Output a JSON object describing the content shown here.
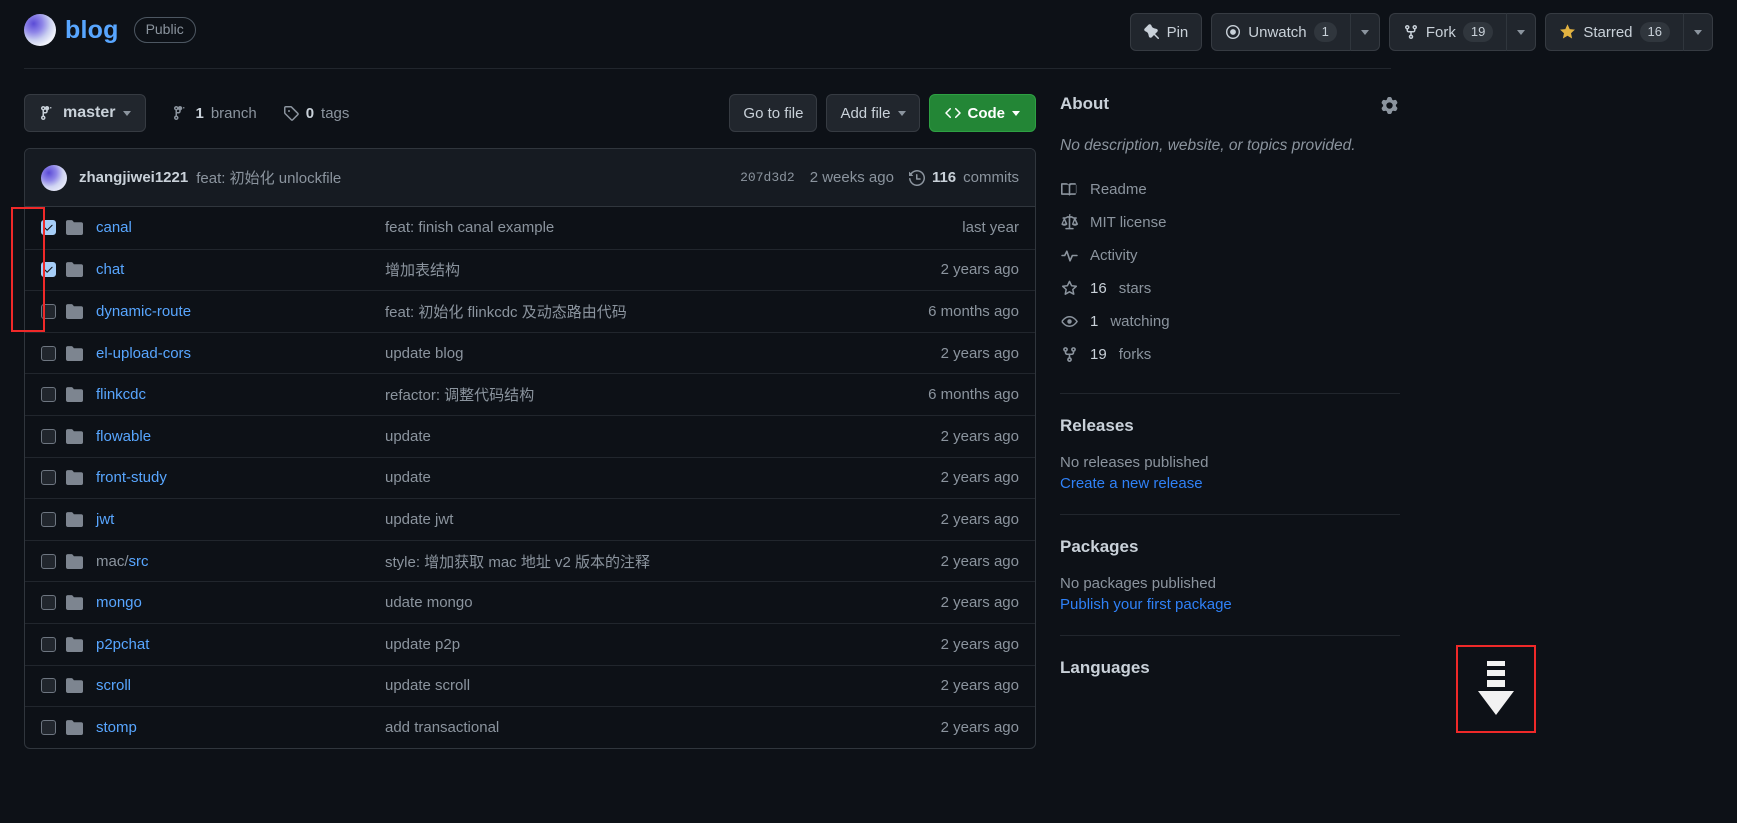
{
  "header": {
    "repo_name": "blog",
    "visibility": "Public",
    "pin_label": "Pin",
    "watch_label": "Unwatch",
    "watch_count": "1",
    "fork_label": "Fork",
    "fork_count": "19",
    "star_label": "Starred",
    "star_count": "16"
  },
  "toolbar": {
    "branch": "master",
    "branch_count": "1",
    "branch_label": "branch",
    "tag_count": "0",
    "tag_label": "tags",
    "go_to_file": "Go to file",
    "add_file": "Add file",
    "code": "Code"
  },
  "commit": {
    "author": "zhangjiwei1221",
    "message": "feat: 初始化 unlockfile",
    "sha": "207d3d2",
    "date": "2 weeks ago",
    "commits_count": "116",
    "commits_label": "commits"
  },
  "files": [
    {
      "name": "canal",
      "name_prefix": "",
      "message": "feat: finish canal example",
      "time": "last year",
      "checked": true
    },
    {
      "name": "chat",
      "name_prefix": "",
      "message": "增加表结构",
      "time": "2 years ago",
      "checked": true
    },
    {
      "name": "dynamic-route",
      "name_prefix": "",
      "message": "feat: 初始化 flinkcdc 及动态路由代码",
      "time": "6 months ago",
      "checked": false
    },
    {
      "name": "el-upload-cors",
      "name_prefix": "",
      "message": "update blog",
      "time": "2 years ago",
      "checked": false
    },
    {
      "name": "flinkcdc",
      "name_prefix": "",
      "message": "refactor: 调整代码结构",
      "time": "6 months ago",
      "checked": false
    },
    {
      "name": "flowable",
      "name_prefix": "",
      "message": "update",
      "time": "2 years ago",
      "checked": false
    },
    {
      "name": "front-study",
      "name_prefix": "",
      "message": "update",
      "time": "2 years ago",
      "checked": false
    },
    {
      "name": "jwt",
      "name_prefix": "",
      "message": "update jwt",
      "time": "2 years ago",
      "checked": false
    },
    {
      "name": "src",
      "name_prefix": "mac/",
      "message": "style: 增加获取 mac 地址 v2 版本的注释",
      "time": "2 years ago",
      "checked": false
    },
    {
      "name": "mongo",
      "name_prefix": "",
      "message": "udate mongo",
      "time": "2 years ago",
      "checked": false
    },
    {
      "name": "p2pchat",
      "name_prefix": "",
      "message": "update p2p",
      "time": "2 years ago",
      "checked": false
    },
    {
      "name": "scroll",
      "name_prefix": "",
      "message": "update scroll",
      "time": "2 years ago",
      "checked": false
    },
    {
      "name": "stomp",
      "name_prefix": "",
      "message": "add transactional",
      "time": "2 years ago",
      "checked": false
    }
  ],
  "about": {
    "title": "About",
    "description": "No description, website, or topics provided.",
    "items": [
      {
        "icon": "book-icon",
        "label": "Readme",
        "muted": true
      },
      {
        "icon": "law-icon",
        "label": "MIT license",
        "muted": true
      },
      {
        "icon": "pulse-icon",
        "label": "Activity",
        "muted": true
      },
      {
        "icon": "star-icon",
        "label": "16",
        "suffix": "stars",
        "muted": false
      },
      {
        "icon": "eye-icon",
        "label": "1",
        "suffix": "watching",
        "muted": false
      },
      {
        "icon": "fork-icon",
        "label": "19",
        "suffix": "forks",
        "muted": false
      }
    ]
  },
  "releases": {
    "title": "Releases",
    "empty": "No releases published",
    "link": "Create a new release"
  },
  "packages": {
    "title": "Packages",
    "empty": "No packages published",
    "link": "Publish your first package"
  },
  "languages": {
    "title": "Languages"
  },
  "colors": {
    "accent": "#58a6ff",
    "green": "#238636",
    "star": "#e3b341",
    "bg": "#0d1117",
    "annotation": "#ef2929"
  }
}
